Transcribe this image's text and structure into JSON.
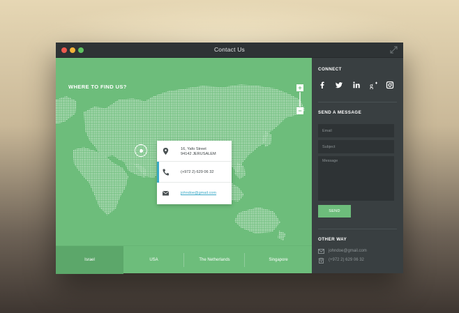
{
  "window": {
    "title": "Contact Us"
  },
  "map": {
    "heading": "WHERE TO FIND US?",
    "zoom_in_label": "+",
    "zoom_out_label": "−",
    "card": {
      "address_line1": "16, Yafo Street",
      "address_line2": "94142 JERUSALEM",
      "phone": "(+972 2) 629 06 32",
      "email": "johndoe@gmail.com"
    }
  },
  "tabs": [
    {
      "label": "Israel",
      "active": true
    },
    {
      "label": "USA",
      "active": false
    },
    {
      "label": "The Netherlands",
      "active": false
    },
    {
      "label": "Singapore",
      "active": false
    }
  ],
  "sidebar": {
    "connect_heading": "CONNECT",
    "social_icons": [
      "facebook-icon",
      "twitter-icon",
      "linkedin-icon",
      "google-plus-icon",
      "instagram-icon"
    ],
    "send_heading": "SEND A MESSAGE",
    "form": {
      "email_placeholder": "Email",
      "subject_placeholder": "Subject",
      "message_placeholder": "Message",
      "send_label": "SEND"
    },
    "other_heading": "OTHER WAY",
    "other_email": "johndoe@gmail.com",
    "other_phone": "(+972 2) 629 06 32"
  },
  "colors": {
    "accent_green": "#6dbd7b",
    "link_blue": "#3aa9c7",
    "sidebar_bg": "#393f41"
  }
}
